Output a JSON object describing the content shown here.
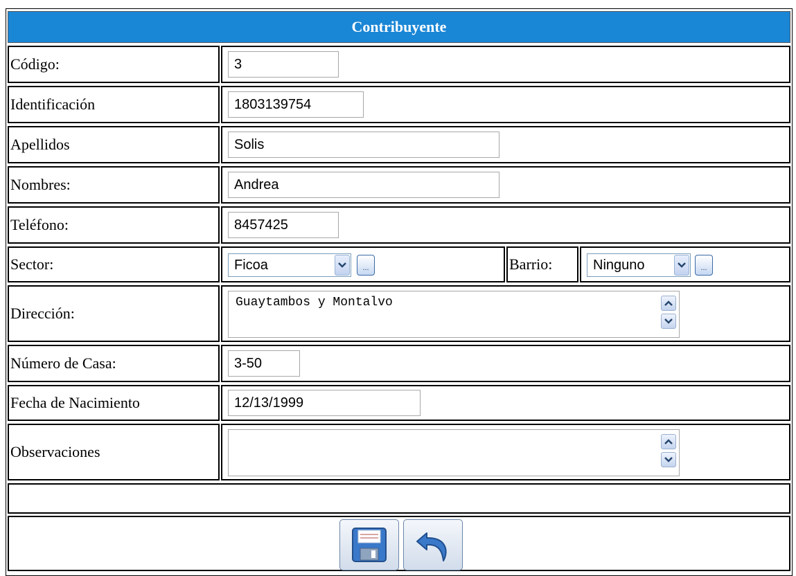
{
  "form": {
    "title": "Contribuyente",
    "fields": {
      "codigo": {
        "label": "Código:",
        "value": "3"
      },
      "identificacion": {
        "label": "Identificación",
        "value": "1803139754"
      },
      "apellidos": {
        "label": "Apellidos",
        "value": "Solis"
      },
      "nombres": {
        "label": "Nombres:",
        "value": "Andrea"
      },
      "telefono": {
        "label": "Teléfono:",
        "value": "8457425"
      },
      "sector": {
        "label": "Sector:",
        "selected": "Ficoa",
        "more_button": "..."
      },
      "barrio": {
        "label": "Barrio:",
        "selected": "Ninguno",
        "more_button": "..."
      },
      "direccion": {
        "label": "Dirección:",
        "value": "Guaytambos y Montalvo"
      },
      "numero_casa": {
        "label": "Número de Casa:",
        "value": "3-50"
      },
      "fecha_nacimiento": {
        "label": "Fecha de Nacimiento",
        "value": "12/13/1999"
      },
      "observaciones": {
        "label": "Observaciones",
        "value": ""
      }
    },
    "message": ""
  },
  "actions": {
    "save_icon": "floppy-disk-icon",
    "undo_icon": "undo-arrow-icon"
  },
  "colors": {
    "header_bg": "#1a86d6",
    "header_text": "#ffffff",
    "button_icon": "#3a78c9"
  }
}
